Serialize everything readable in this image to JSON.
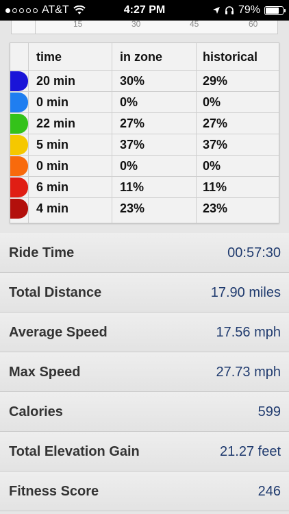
{
  "status_bar": {
    "carrier": "AT&T",
    "signal_dots_filled": 1,
    "signal_dots_total": 5,
    "time": "4:27 PM",
    "battery": "79%",
    "battery_level": 0.79
  },
  "chart_axis": {
    "ticks": [
      "15",
      "30",
      "45",
      "60"
    ]
  },
  "zones_table": {
    "columns": [
      "time",
      "in zone",
      "historical"
    ],
    "rows": [
      {
        "color": "#1a14d8",
        "time": "20 min",
        "in_zone": "30%",
        "historical": "29%"
      },
      {
        "color": "#1f7ef0",
        "time": "0 min",
        "in_zone": "0%",
        "historical": "0%"
      },
      {
        "color": "#34c21a",
        "time": "22 min",
        "in_zone": "27%",
        "historical": "27%"
      },
      {
        "color": "#f5c800",
        "time": "5 min",
        "in_zone": "37%",
        "historical": "37%"
      },
      {
        "color": "#f86a0c",
        "time": "0 min",
        "in_zone": "0%",
        "historical": "0%"
      },
      {
        "color": "#e01e14",
        "time": "6 min",
        "in_zone": "11%",
        "historical": "11%"
      },
      {
        "color": "#b3100c",
        "time": "4 min",
        "in_zone": "23%",
        "historical": "23%"
      }
    ]
  },
  "stats": [
    {
      "label": "Ride Time",
      "value": "00:57:30"
    },
    {
      "label": "Total Distance",
      "value": "17.90 miles"
    },
    {
      "label": "Average Speed",
      "value": "17.56 mph"
    },
    {
      "label": "Max Speed",
      "value": "27.73 mph"
    },
    {
      "label": "Calories",
      "value": "599"
    },
    {
      "label": "Total Elevation Gain",
      "value": "21.27 feet"
    },
    {
      "label": "Fitness Score",
      "value": "246"
    }
  ],
  "icons": {
    "wifi": "wifi-icon",
    "location": "location-arrow-icon",
    "headphones": "headphones-icon",
    "battery": "battery-icon"
  }
}
